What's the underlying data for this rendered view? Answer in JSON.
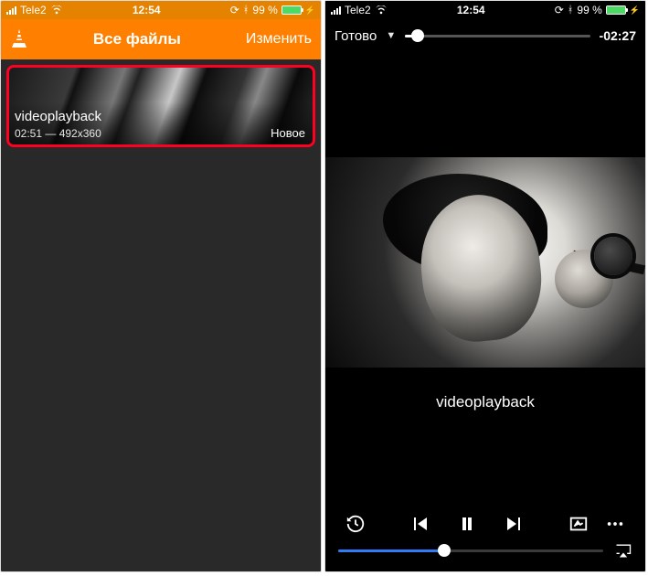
{
  "status": {
    "carrier": "Tele2",
    "time": "12:54",
    "battery_pct": "99 %"
  },
  "left": {
    "title": "Все файлы",
    "edit": "Изменить",
    "items": [
      {
        "name": "videoplayback",
        "meta": "02:51 — 492x360",
        "new_tag": "Новое"
      }
    ]
  },
  "player": {
    "done": "Готово",
    "remaining": "-02:27",
    "title": "videoplayback",
    "top_progress_pct": 7,
    "bottom_progress_pct": 40
  }
}
